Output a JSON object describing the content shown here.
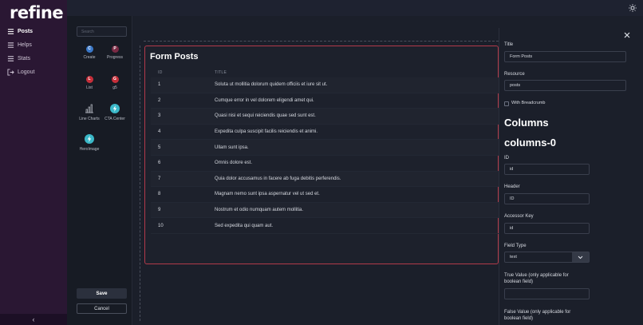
{
  "app": {
    "logo": "refine"
  },
  "sidebar": {
    "items": [
      {
        "label": "Posts",
        "icon": "list-icon",
        "active": true
      },
      {
        "label": "Helps",
        "icon": "list-icon"
      },
      {
        "label": "Stats",
        "icon": "list-icon"
      },
      {
        "label": "Logout",
        "icon": "logout-icon"
      }
    ],
    "collapse_icon": "‹"
  },
  "palette": {
    "search_placeholder": "Search",
    "components": [
      {
        "label": "Create",
        "badge": "C",
        "color": "#3a78c9"
      },
      {
        "label": "Progress",
        "badge": "P",
        "color": "#7a2a44"
      },
      {
        "label": "List",
        "badge": "L",
        "color": "#c62f3a"
      },
      {
        "label": "g5",
        "badge": "G",
        "color": "#c62f3a"
      },
      {
        "label": "Line Charts",
        "icon": "bar-chart-icon"
      },
      {
        "label": "CTA Center",
        "icon": "bolt-icon",
        "color": "#3bb8c8"
      },
      {
        "label": "HeroImage",
        "icon": "bolt-icon",
        "color": "#3bb8c8"
      }
    ],
    "save_label": "Save",
    "cancel_label": "Cancel"
  },
  "card": {
    "title": "Form Posts",
    "columns": [
      "ID",
      "TITLE"
    ],
    "rows": [
      {
        "id": "1",
        "title": "Soluta ut mollitia dolorum quidem officiis et iure sit ut."
      },
      {
        "id": "2",
        "title": "Cumque error in vel dolorem eligendi amet qui."
      },
      {
        "id": "3",
        "title": "Quasi nisi et sequi reiciendis quae sed sunt est."
      },
      {
        "id": "4",
        "title": "Expedita culpa suscipit facilis reiciendis et animi."
      },
      {
        "id": "5",
        "title": "Ullam sunt ipsa."
      },
      {
        "id": "6",
        "title": "Omnis dolore est."
      },
      {
        "id": "7",
        "title": "Quia dolor accusamus in facere ab fuga debitis perferendis."
      },
      {
        "id": "8",
        "title": "Magnam nemo sunt ipsa aspernatur vel ut sed et."
      },
      {
        "id": "9",
        "title": "Nostrum et odio numquam autem mollitia."
      },
      {
        "id": "10",
        "title": "Sed expedita qui quam aut."
      }
    ]
  },
  "panel": {
    "title_label": "Title",
    "title_value": "Form Posts",
    "resource_label": "Resource",
    "resource_value": "posts",
    "breadcrumb_label": "With Breadcrumb",
    "breadcrumb_checked": false,
    "columns_heading": "Columns",
    "column_heading": "columns-0",
    "id_label": "ID",
    "id_value": "id",
    "header_label": "Header",
    "header_value": "ID",
    "accessor_label": "Accessor Key",
    "accessor_value": "id",
    "field_type_label": "Field Type",
    "field_type_value": "text",
    "true_value_label": "True Value (only applicable for boolean field)",
    "true_value_value": "",
    "false_value_label": "False Value (only applicable for boolean field)"
  }
}
